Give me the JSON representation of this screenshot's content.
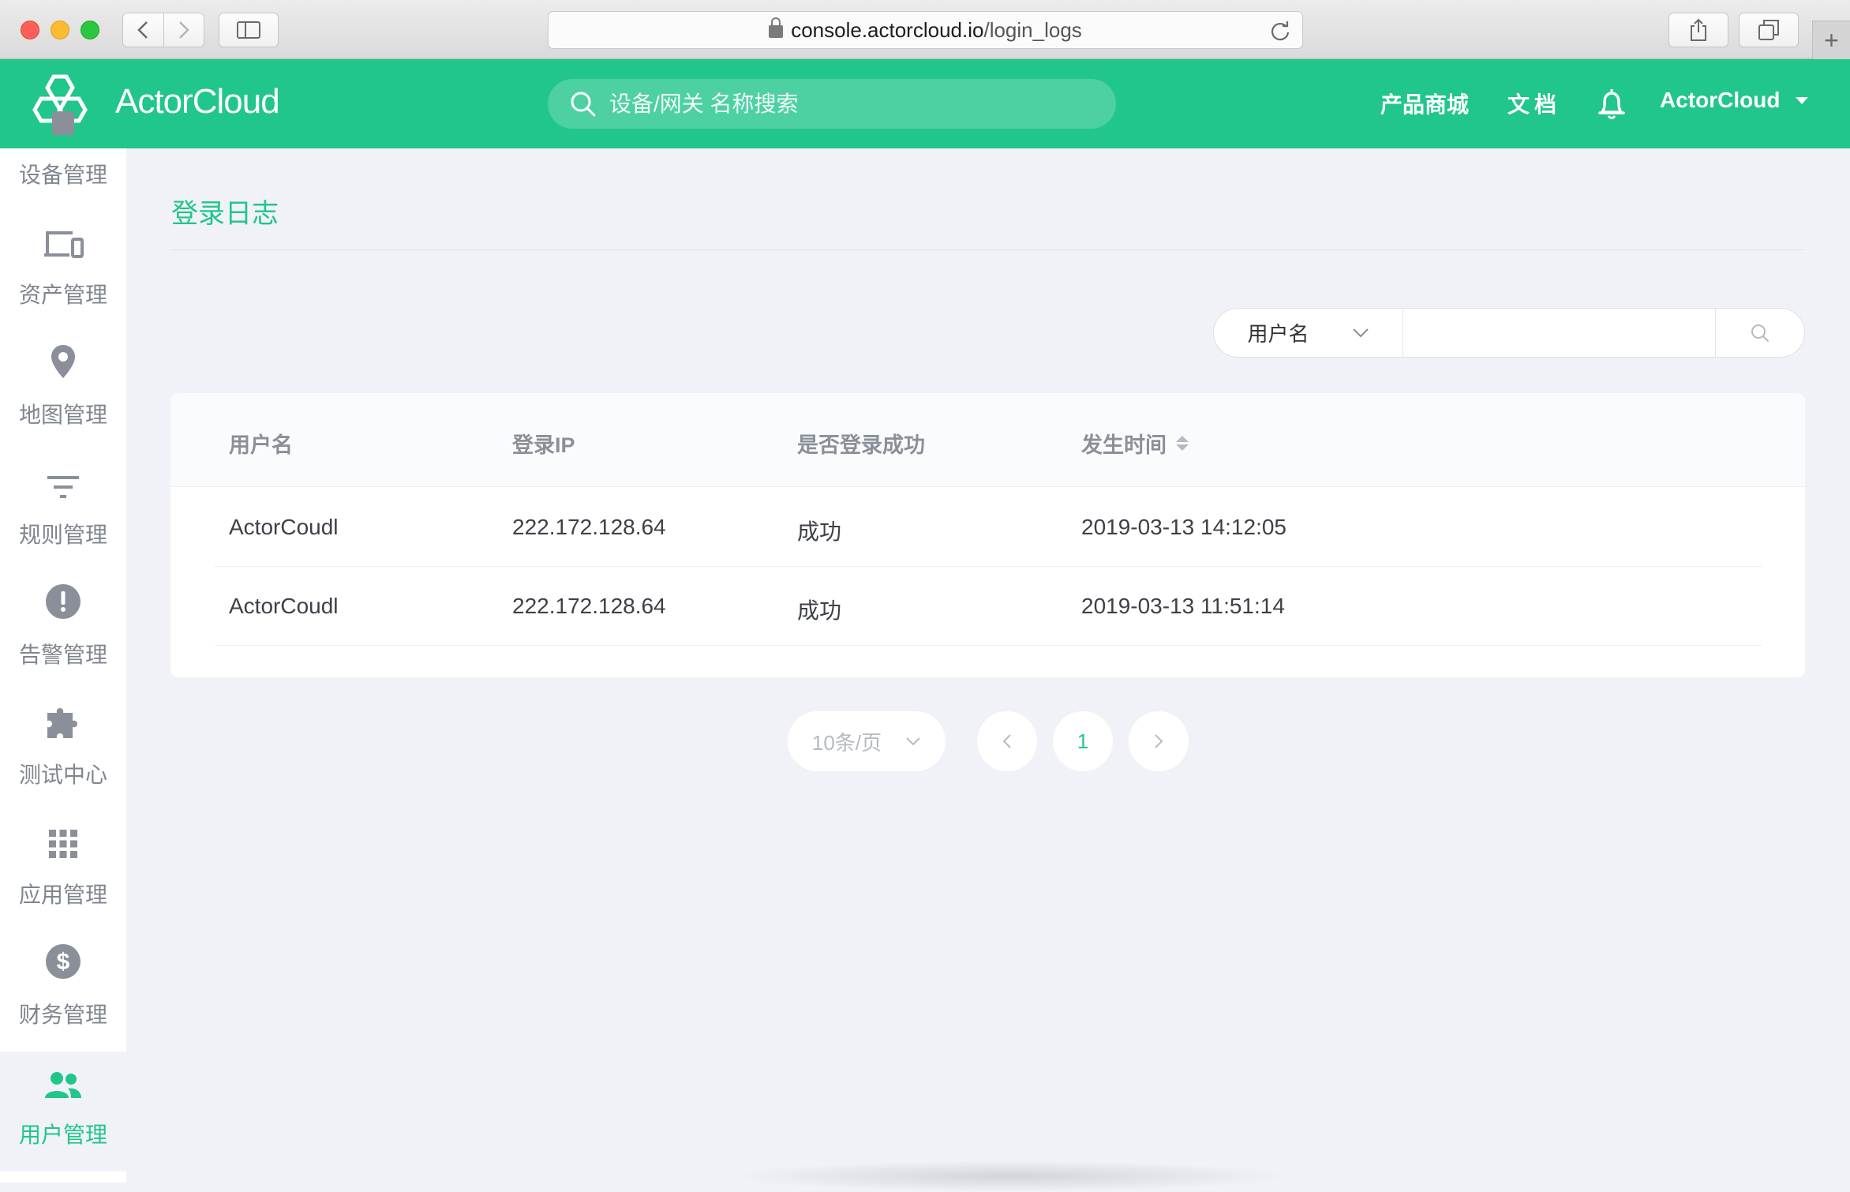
{
  "browser": {
    "url_host": "console.actorcloud.io",
    "url_path": "/login_logs"
  },
  "header": {
    "logo_text": "ActorCloud",
    "search_placeholder": "设备/网关 名称搜索",
    "links": {
      "store": "产品商城",
      "docs": "文档"
    },
    "user_name": "ActorCloud",
    "brand_color": "#21c68b"
  },
  "sidebar": {
    "items": [
      {
        "label": "设备管理",
        "icon": "device-icon",
        "active": false
      },
      {
        "label": "资产管理",
        "icon": "devices-asset-icon",
        "active": false
      },
      {
        "label": "地图管理",
        "icon": "map-pin-icon",
        "active": false
      },
      {
        "label": "规则管理",
        "icon": "filter-icon",
        "active": false
      },
      {
        "label": "告警管理",
        "icon": "alert-icon",
        "active": false
      },
      {
        "label": "测试中心",
        "icon": "puzzle-icon",
        "active": false
      },
      {
        "label": "应用管理",
        "icon": "grid-icon",
        "active": false
      },
      {
        "label": "财务管理",
        "icon": "dollar-icon",
        "active": false
      },
      {
        "label": "用户管理",
        "icon": "users-icon",
        "active": true
      }
    ]
  },
  "main": {
    "title": "登录日志",
    "filter": {
      "field_label": "用户名",
      "value": ""
    },
    "table": {
      "columns": [
        "用户名",
        "登录IP",
        "是否登录成功",
        "发生时间"
      ],
      "rows": [
        [
          "ActorCoudl",
          "222.172.128.64",
          "成功",
          "2019-03-13 14:12:05"
        ],
        [
          "ActorCoudl",
          "222.172.128.64",
          "成功",
          "2019-03-13 11:51:14"
        ]
      ]
    },
    "pagination": {
      "page_size": "10条/页",
      "current_page": "1"
    }
  }
}
